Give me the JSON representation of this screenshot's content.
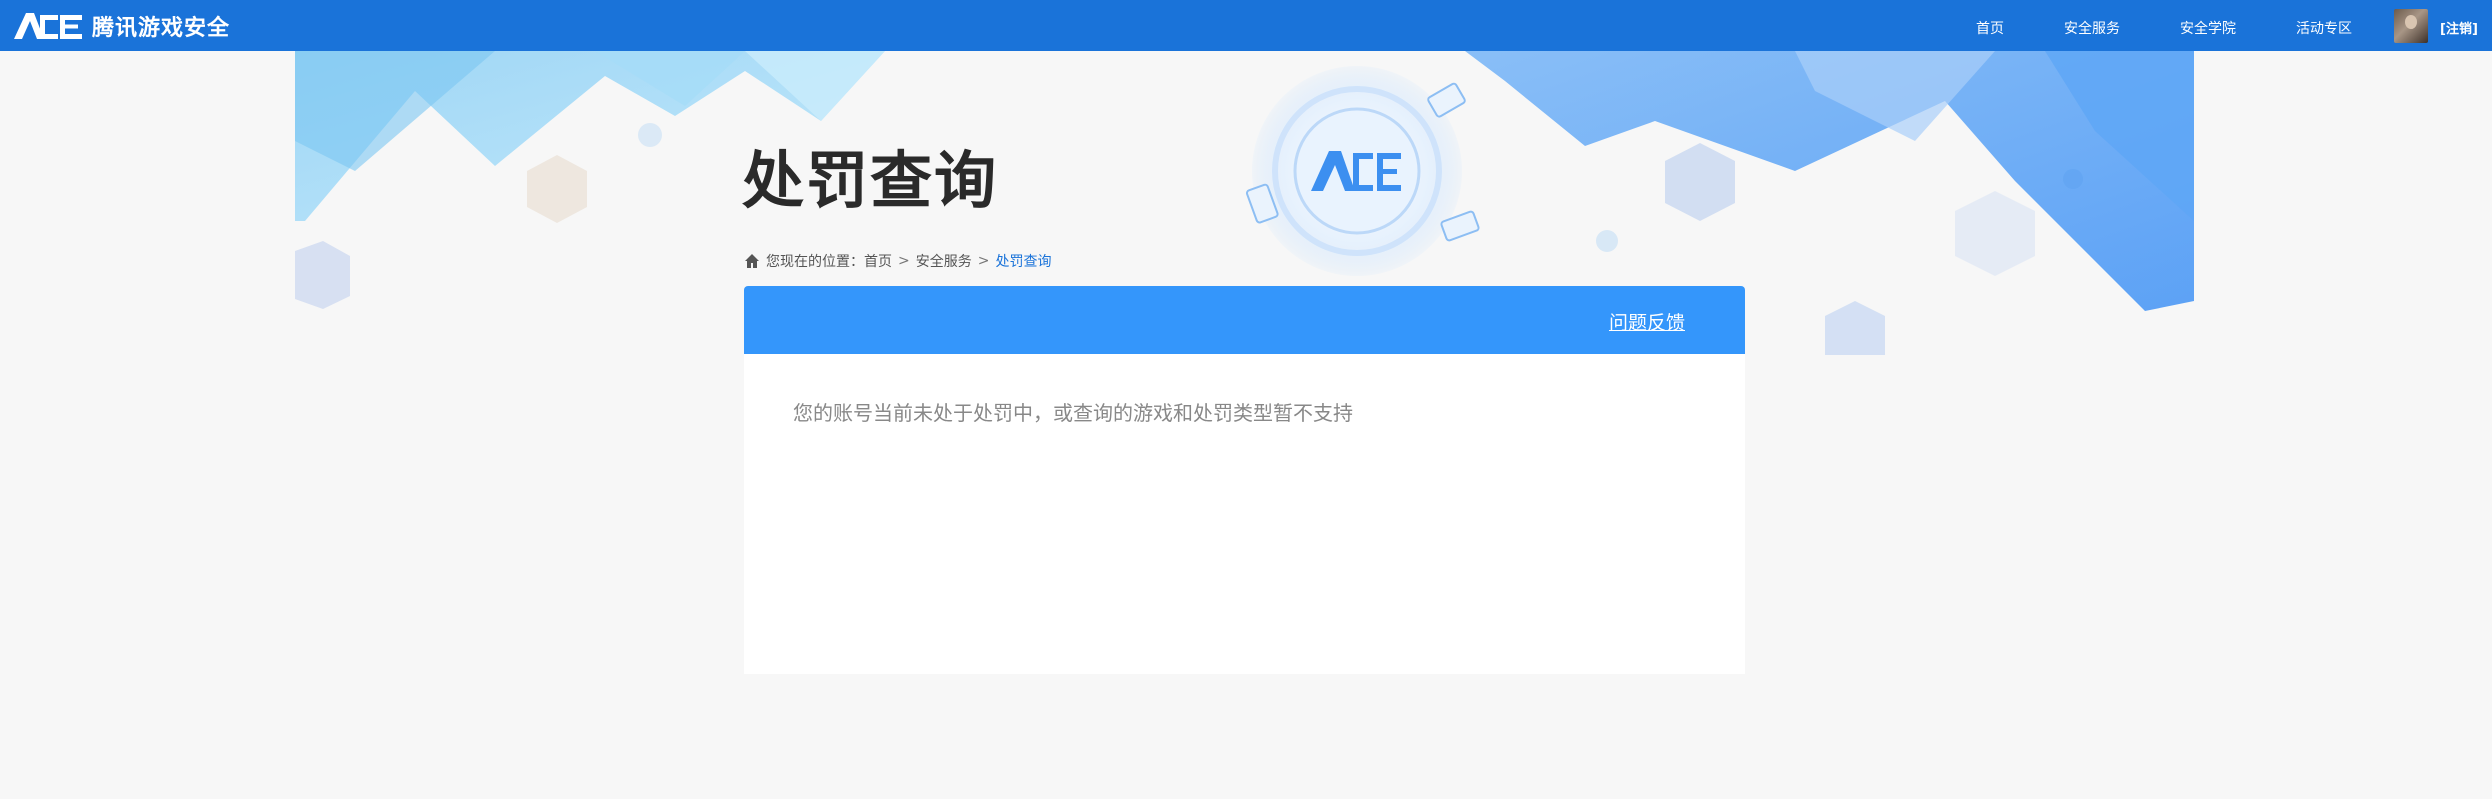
{
  "header": {
    "brand_name": "腾讯游戏安全",
    "nav": [
      {
        "label": "首页"
      },
      {
        "label": "安全服务"
      },
      {
        "label": "安全学院"
      },
      {
        "label": "活动专区"
      }
    ],
    "logout_label": "[注销]"
  },
  "page": {
    "title": "处罚查询"
  },
  "breadcrumb": {
    "prefix": "您现在的位置：",
    "items": [
      "首页",
      "安全服务"
    ],
    "current": "处罚查询",
    "separator": ">"
  },
  "panel": {
    "feedback_label": "问题反馈",
    "message": "您的账号当前未处于处罚中，或查询的游戏和处罚类型暂不支持"
  },
  "colors": {
    "topbar": "#1a73d9",
    "panel_header": "#3496fb",
    "accent": "#1a73d9"
  }
}
